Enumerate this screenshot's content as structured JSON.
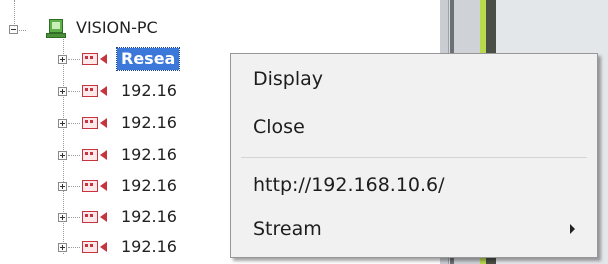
{
  "tree": {
    "root": {
      "label": "VISION-PC"
    },
    "children": [
      {
        "label": "Resea",
        "selected": true
      },
      {
        "label": "192.16"
      },
      {
        "label": "192.16"
      },
      {
        "label": "192.16"
      },
      {
        "label": "192.16"
      },
      {
        "label": "192.16"
      },
      {
        "label": "192.16"
      }
    ]
  },
  "context_menu": {
    "items": [
      {
        "label": "Display"
      },
      {
        "label": "Close"
      },
      {
        "label": "http://192.168.10.6/"
      },
      {
        "label": "Stream",
        "has_submenu": true
      }
    ]
  },
  "colors": {
    "selection": "#3b78d9",
    "camera_icon": "#c6353f",
    "pc_icon": "#5fb04a",
    "menu_background": "#f1f1f1"
  }
}
